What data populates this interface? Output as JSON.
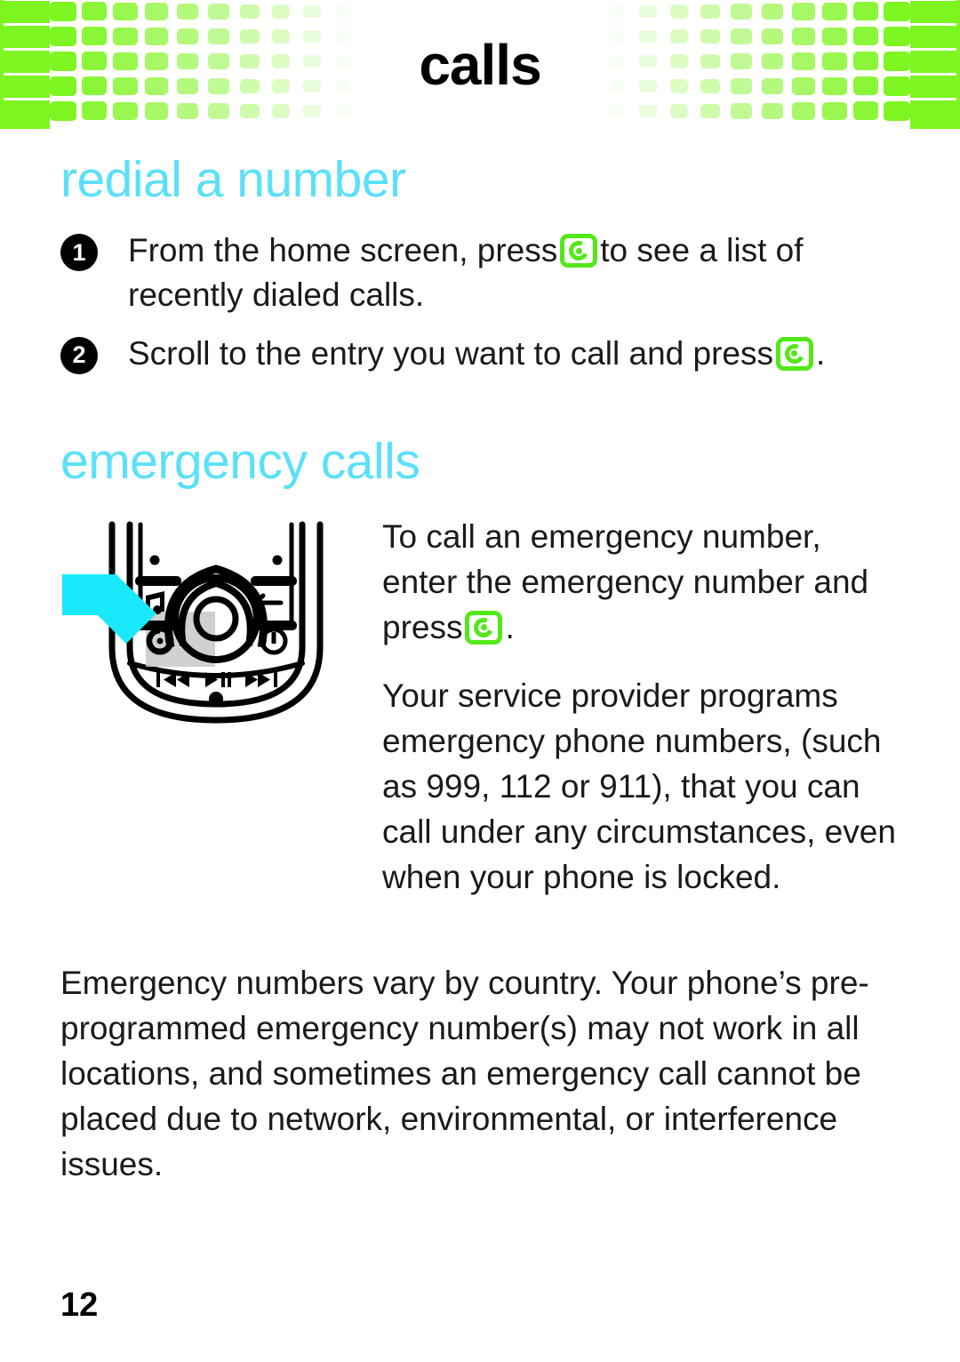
{
  "header": {
    "title": "calls",
    "accent_green": "#7df520",
    "pattern": "fading-rounded-square-grid"
  },
  "theme": {
    "heading_cyan": "#5be0fa",
    "key_icon_green": "#52e818",
    "arrow_cyan": "#19e9fb",
    "body_text": "#1a1a1a"
  },
  "sections": [
    {
      "heading": "redial a number",
      "steps": [
        {
          "number": "1",
          "text_before": "From the home screen, press",
          "icon": "call-key-icon",
          "text_after": "to see a list of recently dialed calls."
        },
        {
          "number": "2",
          "text_before": "Scroll to the entry you want to call and press",
          "icon": "call-key-icon",
          "text_after": "."
        }
      ]
    },
    {
      "heading": "emergency calls",
      "figure": {
        "name": "phone-keypad-illustration",
        "callout_arrow": "arrow pointing to call key",
        "keys": [
          "music-note-key",
          "call-key",
          "back-arrow-key",
          "power-key",
          "navigation-wheel",
          "previous-track-key",
          "play-pause-key",
          "next-track-key"
        ]
      },
      "paragraphs": [
        {
          "text_before": "To call an emergency number, enter the emergency number and press",
          "icon": "call-key-icon",
          "text_after": "."
        },
        {
          "text": "Your service provider programs emergency phone numbers, (such as 999, 112 or 911), that you can call under any circumstances, even when your phone is locked."
        },
        {
          "text": "Emergency numbers vary by country. Your phone’s pre-programmed emergency number(s) may not work in all locations, and sometimes an emergency call cannot be placed due to network, environmental, or interference issues."
        }
      ]
    }
  ],
  "footer": {
    "page_number": "12"
  }
}
